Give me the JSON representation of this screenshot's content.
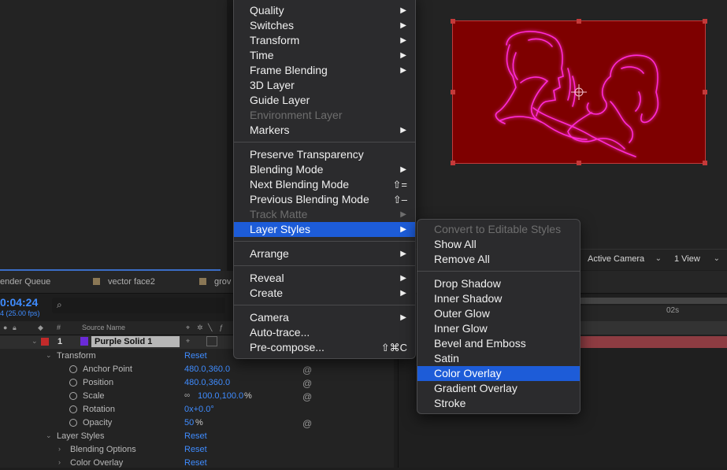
{
  "colors": {
    "accent_blue": "#3f8cff",
    "menu_highlight": "#1d5cd8",
    "comp_background": "#7e0000",
    "neon_pink": "#ff2bd6",
    "layer_label_purple": "#6a2ad8",
    "layer_label_red": "#c22a2a",
    "timeline_bar": "#8e3c42"
  },
  "viewer": {
    "camera_select": "Active Camera",
    "view_select": "1 View"
  },
  "timeline": {
    "tabs": [
      {
        "label": "ender Queue"
      },
      {
        "label": "vector face2"
      },
      {
        "label": "grov"
      }
    ],
    "timecode": "0:04:24",
    "fps": "4 (25.00 fps)",
    "search_icon": "search-icon",
    "columns": {
      "number": "#",
      "source_name": "Source Name"
    },
    "ruler_label": "02s",
    "layer": {
      "number": "1",
      "name": "Purple Solid 1"
    },
    "properties": {
      "transform": {
        "label": "Transform",
        "reset": "Reset"
      },
      "anchor_point": {
        "label": "Anchor Point",
        "value": "480.0,360.0"
      },
      "position": {
        "label": "Position",
        "value": "480.0,360.0"
      },
      "scale": {
        "label": "Scale",
        "value": "100.0,100.0",
        "unit": "%"
      },
      "rotation": {
        "label": "Rotation",
        "value": "0x+0.0°"
      },
      "opacity": {
        "label": "Opacity",
        "value": "50",
        "unit": "%"
      },
      "layer_styles": {
        "label": "Layer Styles",
        "reset": "Reset"
      },
      "blending_options": {
        "label": "Blending Options",
        "reset": "Reset"
      },
      "color_overlay": {
        "label": "Color Overlay",
        "reset": "Reset"
      }
    }
  },
  "context_menu": {
    "items": [
      {
        "label": "Quality",
        "submenu": true
      },
      {
        "label": "Switches",
        "submenu": true
      },
      {
        "label": "Transform",
        "submenu": true
      },
      {
        "label": "Time",
        "submenu": true
      },
      {
        "label": "Frame Blending",
        "submenu": true
      },
      {
        "label": "3D Layer"
      },
      {
        "label": "Guide Layer"
      },
      {
        "label": "Environment Layer",
        "disabled": true
      },
      {
        "label": "Markers",
        "submenu": true
      },
      {
        "label": "Preserve Transparency"
      },
      {
        "label": "Blending Mode",
        "submenu": true
      },
      {
        "label": "Next Blending Mode",
        "shortcut": "⇧="
      },
      {
        "label": "Previous Blending Mode",
        "shortcut": "⇧–"
      },
      {
        "label": "Track Matte",
        "submenu": true,
        "disabled": true
      },
      {
        "label": "Layer Styles",
        "submenu": true,
        "highlighted": true
      },
      {
        "label": "Arrange",
        "submenu": true
      },
      {
        "label": "Reveal",
        "submenu": true
      },
      {
        "label": "Create",
        "submenu": true
      },
      {
        "label": "Camera",
        "submenu": true
      },
      {
        "label": "Auto-trace..."
      },
      {
        "label": "Pre-compose...",
        "shortcut": "⇧⌘C"
      }
    ]
  },
  "layer_styles_menu": {
    "items": [
      {
        "label": "Convert to Editable Styles",
        "disabled": true
      },
      {
        "label": "Show All"
      },
      {
        "label": "Remove All"
      },
      {
        "label": "Drop Shadow"
      },
      {
        "label": "Inner Shadow"
      },
      {
        "label": "Outer Glow"
      },
      {
        "label": "Inner Glow"
      },
      {
        "label": "Bevel and Emboss"
      },
      {
        "label": "Satin"
      },
      {
        "label": "Color Overlay",
        "highlighted": true
      },
      {
        "label": "Gradient Overlay"
      },
      {
        "label": "Stroke"
      }
    ]
  }
}
